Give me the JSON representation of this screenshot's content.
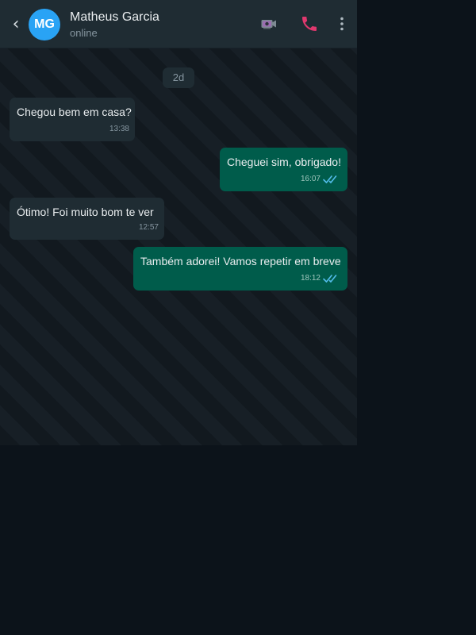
{
  "header": {
    "back_glyph": "‹",
    "avatar_initials": "MG",
    "contact_name": "Matheus Garcia",
    "status": "online",
    "icons": {
      "back": "back-arrow-icon",
      "video": "video-camera-icon",
      "call": "phone-call-icon",
      "menu": "more-vertical-icon"
    }
  },
  "chat": {
    "date_label": "2d",
    "messages": [
      {
        "direction": "incoming",
        "text": "Chegou bem em casa?",
        "time": "13:38"
      },
      {
        "direction": "outgoing",
        "text": "Cheguei sim, obrigado!",
        "time": "16:07",
        "status": "read"
      },
      {
        "direction": "incoming",
        "text": "Ótimo! Foi muito bom te ver",
        "time": "12:57"
      },
      {
        "direction": "outgoing",
        "text": "Também adorei! Vamos repetir em breve",
        "time": "18:12",
        "status": "read"
      }
    ]
  },
  "colors": {
    "header_bg": "#1f2c33",
    "incoming_bubble": "#1f2c33",
    "outgoing_bubble": "#005c4b",
    "avatar": "#29a3f5",
    "call_icon": "#e0386e",
    "read_ticks": "#53bdeb",
    "page_bg": "#0c131a"
  }
}
